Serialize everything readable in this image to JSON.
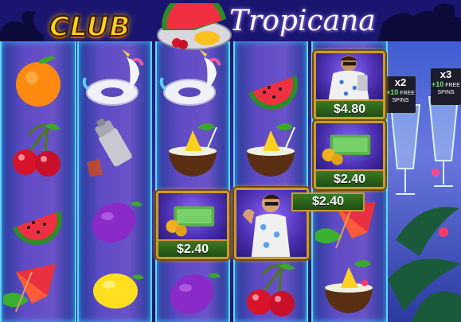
{
  "game": {
    "title_part1": "CLUB",
    "title_part2": "Tropicana"
  },
  "cash_values": {
    "reel5_top": "$4.80",
    "reel5_mid": "$2.40",
    "reel3_cash": "$2.40",
    "reel4_collector": "$2.40"
  },
  "multipliers": [
    {
      "value": "x2",
      "spins_prefix": "+10",
      "spins_label": "FREE SPINS"
    },
    {
      "value": "x3",
      "spins_prefix": "+10",
      "spins_label": "FREE SPINS"
    }
  ],
  "reels": [
    [
      "orange-icon",
      "cherries-icon",
      "watermelon-icon",
      "parasol-drink-icon"
    ],
    [
      "unicorn-float-icon",
      "cocktail-shaker-icon",
      "plum-icon",
      "lemon-icon"
    ],
    [
      "unicorn-float-icon",
      "coconut-drink-icon",
      "cash-symbol",
      "plum-icon"
    ],
    [
      "watermelon-icon",
      "coconut-drink-icon",
      "dj-collector-symbol",
      "cherries-icon"
    ],
    [
      "dj-collector-symbol",
      "cash-symbol",
      "parasol-drink-icon",
      "coconut-drink-icon"
    ]
  ],
  "colors": {
    "reel_border": "#5fd6ff",
    "cash_frame": "#c99a2e",
    "cash_label_bg": "#2f6a1c",
    "logo_gold": "#ffd21a"
  }
}
